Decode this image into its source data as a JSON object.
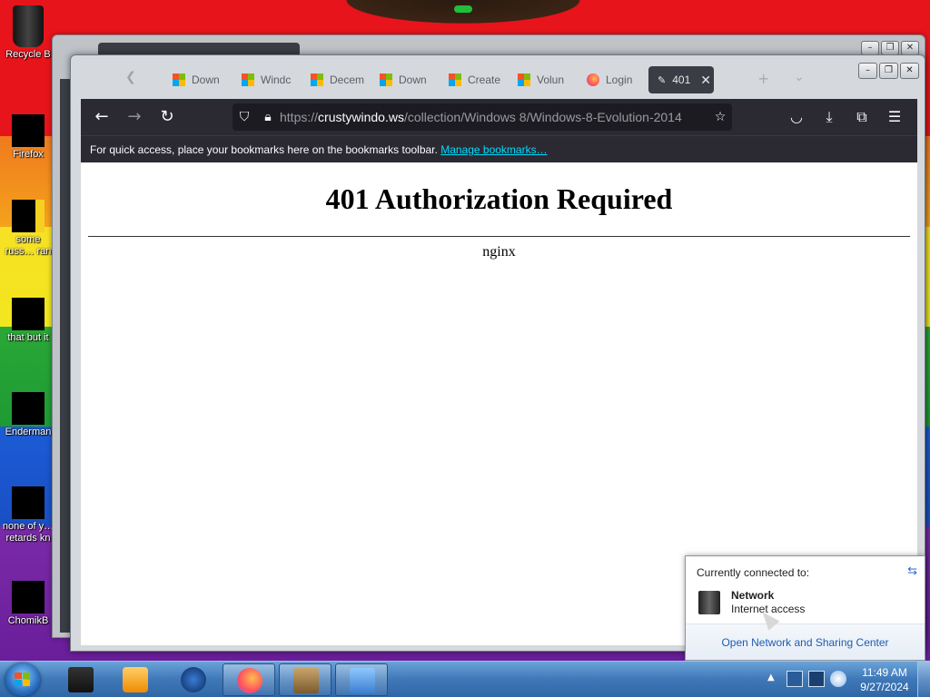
{
  "desktop": {
    "icons": [
      {
        "label": "Recycle B"
      },
      {
        "label": "Firefox"
      },
      {
        "label": "some russ… ran a ra"
      },
      {
        "label": "that but it"
      },
      {
        "label": "Enderman"
      },
      {
        "label": "none of y… retards kn"
      },
      {
        "label": "ChomikB"
      }
    ]
  },
  "browser": {
    "tabs": [
      {
        "label": "Down",
        "icon": "windows-logo-icon"
      },
      {
        "label": "Windc",
        "icon": "windows-logo-icon"
      },
      {
        "label": "Decem",
        "icon": "windows-logo-icon"
      },
      {
        "label": "Down",
        "icon": "windows-logo-icon"
      },
      {
        "label": "Create",
        "icon": "windows-logo-icon"
      },
      {
        "label": "Volun",
        "icon": "windows-logo-icon"
      },
      {
        "label": "Login",
        "icon": "firefox-icon"
      },
      {
        "label": "401",
        "icon": "page-icon",
        "active": true
      }
    ],
    "url_host": "crustywindo.ws",
    "url_prefix": "https://",
    "url_path": "/collection/Windows 8/Windows-8-Evolution-2014",
    "bookmarks_text": "For quick access, place your bookmarks here on the bookmarks toolbar.",
    "bookmarks_link": "Manage bookmarks…",
    "page": {
      "heading": "401 Authorization Required",
      "server": "nginx"
    }
  },
  "network_flyout": {
    "heading": "Currently connected to:",
    "network_name": "Network",
    "network_status": "Internet access",
    "footer_link": "Open Network and Sharing Center"
  },
  "taskbar": {
    "time": "11:49 AM",
    "date": "9/27/2024"
  }
}
